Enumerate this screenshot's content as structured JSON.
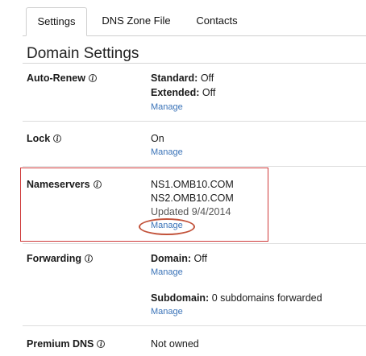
{
  "tabs": [
    {
      "label": "Settings",
      "active": true
    },
    {
      "label": "DNS Zone File",
      "active": false
    },
    {
      "label": "Contacts",
      "active": false
    }
  ],
  "page_title": "Domain Settings",
  "auto_renew": {
    "label": "Auto-Renew",
    "standard_label": "Standard:",
    "standard_value": " Off",
    "extended_label": "Extended:",
    "extended_value": " Off",
    "manage": "Manage"
  },
  "lock": {
    "label": "Lock",
    "value": "On",
    "manage": "Manage"
  },
  "nameservers": {
    "label": "Nameservers",
    "ns1": "NS1.OMB10.COM",
    "ns2": "NS2.OMB10.COM",
    "updated": "Updated 9/4/2014",
    "manage": "Manage"
  },
  "forwarding": {
    "label": "Forwarding",
    "domain_label": "Domain:",
    "domain_value": " Off",
    "manage_domain": "Manage",
    "subdomain_label": "Subdomain:",
    "subdomain_value": " 0 subdomains forwarded",
    "manage_subdomain": "Manage"
  },
  "premium_dns": {
    "label": "Premium DNS",
    "value": "Not owned"
  },
  "colors": {
    "link": "#3a73b8",
    "highlight_box": "#cf3b3b",
    "highlight_oval": "#c2523a"
  }
}
